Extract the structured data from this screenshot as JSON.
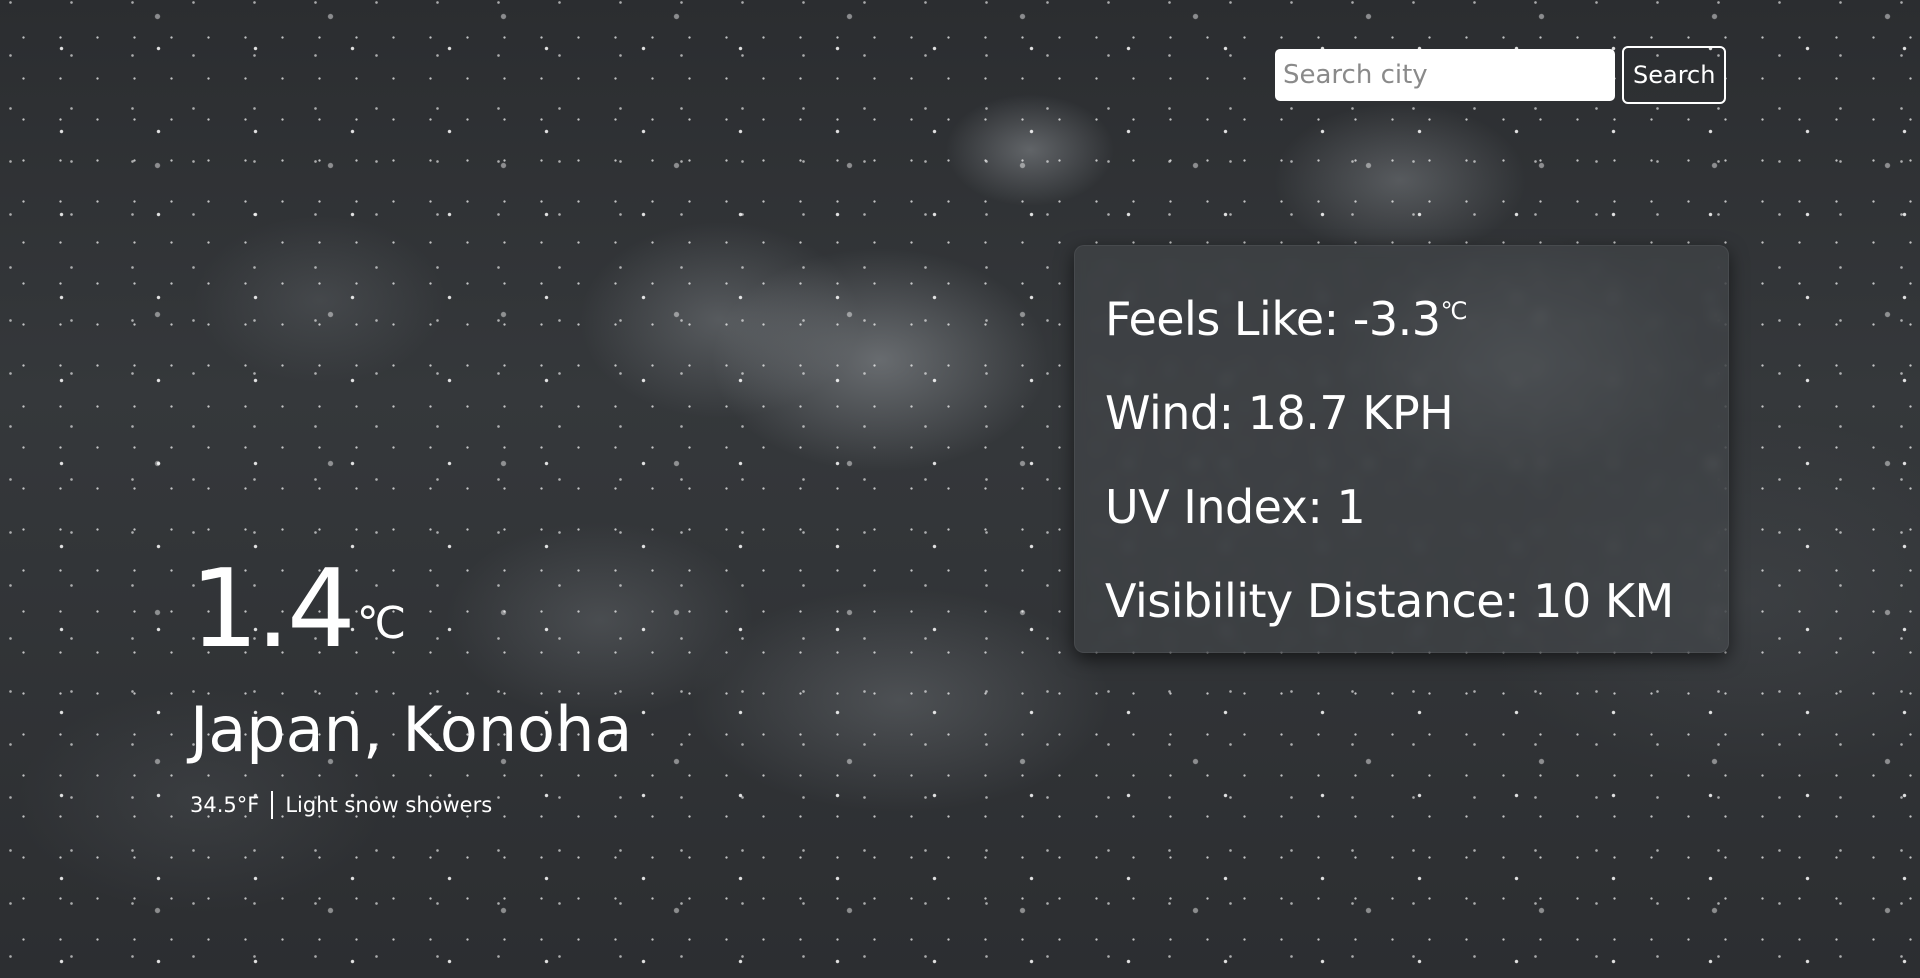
{
  "search": {
    "placeholder": "Search city",
    "button_label": "Search"
  },
  "details": {
    "feels_like_label": "Feels Like:",
    "feels_like_value": "-3.3",
    "feels_like_unit": "℃",
    "wind_label": "Wind:",
    "wind_value": "18.7 KPH",
    "uv_label": "UV Index:",
    "uv_value": "1",
    "visibility_label": "Visibility Distance:",
    "visibility_value": "10 KM"
  },
  "current": {
    "temperature": "1.4",
    "temperature_unit": "℃",
    "location": "Japan, Konoha",
    "fahrenheit": "34.5°F",
    "condition": "Light snow showers"
  }
}
